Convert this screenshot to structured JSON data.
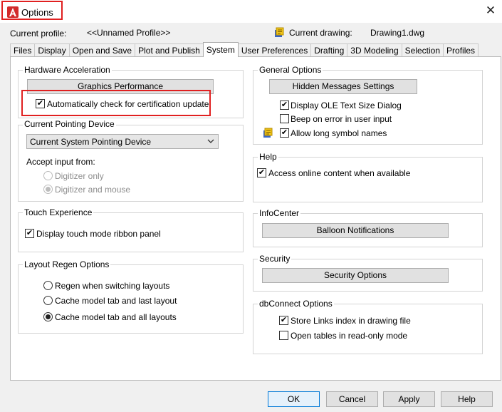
{
  "window": {
    "title": "Options",
    "close_glyph": "✕"
  },
  "header": {
    "current_profile_label": "Current profile:",
    "current_profile_value": "<<Unnamed Profile>>",
    "current_drawing_label": "Current drawing:",
    "current_drawing_value": "Drawing1.dwg"
  },
  "tabs": [
    {
      "label": "Files",
      "active": false
    },
    {
      "label": "Display",
      "active": false
    },
    {
      "label": "Open and Save",
      "active": false
    },
    {
      "label": "Plot and Publish",
      "active": false
    },
    {
      "label": "System",
      "active": true
    },
    {
      "label": "User Preferences",
      "active": false
    },
    {
      "label": "Drafting",
      "active": false
    },
    {
      "label": "3D Modeling",
      "active": false
    },
    {
      "label": "Selection",
      "active": false
    },
    {
      "label": "Profiles",
      "active": false
    }
  ],
  "hardware_acceleration": {
    "title": "Hardware Acceleration",
    "graphics_button": "Graphics Performance",
    "auto_check_label": "Automatically check for certification update",
    "auto_check_checked": true
  },
  "pointing_device": {
    "title": "Current Pointing Device",
    "selected": "Current System Pointing Device",
    "accept_input_label": "Accept input from:",
    "digitizer_only": "Digitizer only",
    "digitizer_and_mouse": "Digitizer and mouse"
  },
  "touch_experience": {
    "title": "Touch Experience",
    "ribbon_label": "Display touch mode ribbon panel",
    "ribbon_checked": true
  },
  "layout_regen": {
    "title": "Layout Regen Options",
    "options": [
      {
        "label": "Regen when switching layouts",
        "checked": false
      },
      {
        "label": "Cache model tab and last layout",
        "checked": false
      },
      {
        "label": "Cache model tab and all layouts",
        "checked": true
      }
    ]
  },
  "general_options": {
    "title": "General Options",
    "hidden_messages_button": "Hidden Messages Settings",
    "ole_label": "Display OLE Text Size Dialog",
    "ole_checked": true,
    "beep_label": "Beep on error in user input",
    "beep_checked": false,
    "long_names_label": "Allow long symbol names",
    "long_names_checked": true
  },
  "help": {
    "title": "Help",
    "online_label": "Access online content when available",
    "online_checked": true
  },
  "infocenter": {
    "title": "InfoCenter",
    "balloon_button": "Balloon Notifications"
  },
  "security": {
    "title": "Security",
    "security_button": "Security Options"
  },
  "dbconnect": {
    "title": "dbConnect Options",
    "store_links_label": "Store Links index in drawing file",
    "store_links_checked": true,
    "open_tables_label": "Open tables in read-only mode",
    "open_tables_checked": false
  },
  "footer": {
    "ok": "OK",
    "cancel": "Cancel",
    "apply": "Apply",
    "help": "Help"
  },
  "colors": {
    "highlight": "#e02020",
    "focus_border": "#0078d7",
    "app_icon": "#d22b2b"
  }
}
